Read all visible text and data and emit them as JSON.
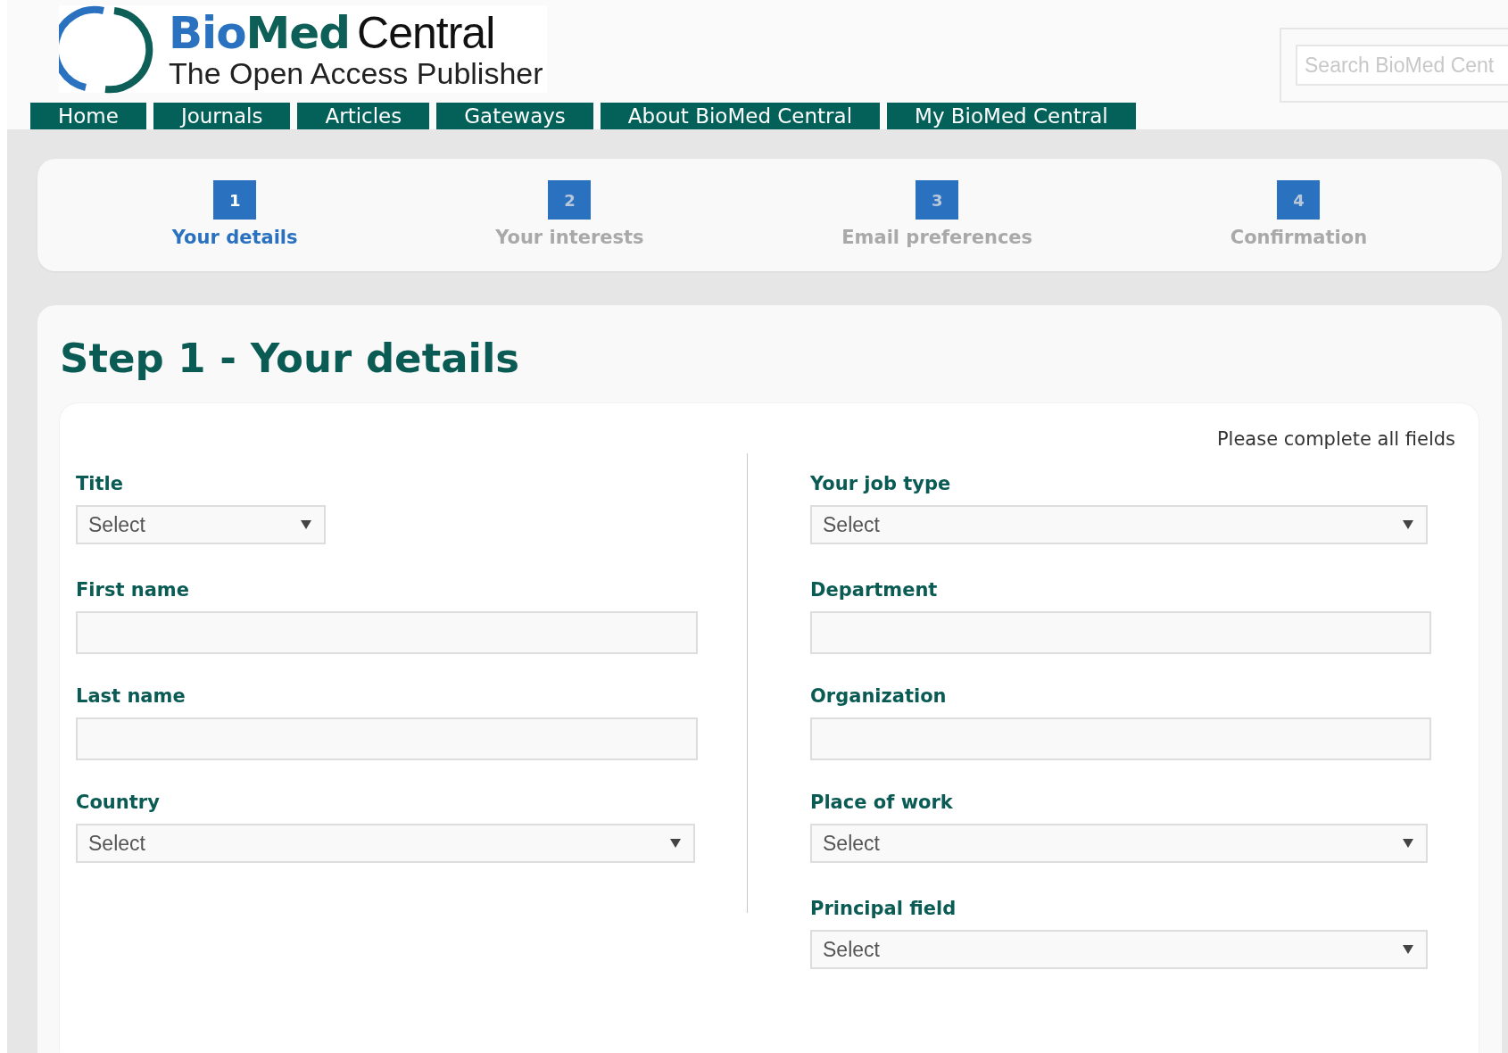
{
  "header": {
    "logo": {
      "bio": "Bio",
      "med": "Med",
      "central": "Central",
      "tagline": "The Open Access Publisher"
    },
    "search": {
      "placeholder": "Search BioMed Cent"
    }
  },
  "nav": [
    {
      "label": "Home"
    },
    {
      "label": "Journals"
    },
    {
      "label": "Articles"
    },
    {
      "label": "Gateways"
    },
    {
      "label": "About BioMed Central"
    },
    {
      "label": "My BioMed Central"
    }
  ],
  "steps": [
    {
      "number": "1",
      "label": "Your details",
      "selected": true
    },
    {
      "number": "2",
      "label": "Your interests",
      "selected": false
    },
    {
      "number": "3",
      "label": "Email preferences",
      "selected": false
    },
    {
      "number": "4",
      "label": "Confirmation",
      "selected": false
    }
  ],
  "form": {
    "title": "Step 1 - Your details",
    "note": "Please complete all fields",
    "left": [
      {
        "label": "Title",
        "kind": "short-select",
        "value": "Select"
      },
      {
        "label": "First name",
        "kind": "text"
      },
      {
        "label": "Last name",
        "kind": "text"
      },
      {
        "label": "Country",
        "kind": "select",
        "value": "Select"
      }
    ],
    "right": [
      {
        "label": "Your job type",
        "kind": "select",
        "value": "Select"
      },
      {
        "label": "Department",
        "kind": "text"
      },
      {
        "label": "Organization",
        "kind": "text"
      },
      {
        "label": "Place of work",
        "kind": "select",
        "value": "Select"
      },
      {
        "label": "Principal field",
        "kind": "select",
        "value": "Select"
      }
    ]
  }
}
